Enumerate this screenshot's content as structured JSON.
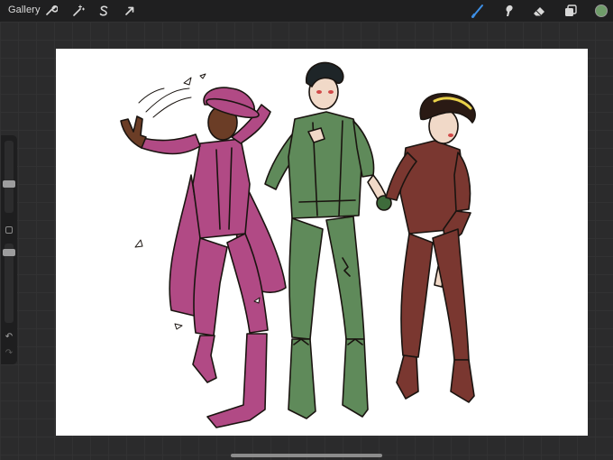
{
  "topbar": {
    "gallery_label": "Gallery",
    "left_tools": [
      {
        "icon": "wrench-icon",
        "name": "actions"
      },
      {
        "icon": "magic-wand-icon",
        "name": "adjustments"
      },
      {
        "icon": "selection-s-icon",
        "name": "selection"
      },
      {
        "icon": "arrow-cursor-icon",
        "name": "transform"
      }
    ],
    "right_tools": [
      {
        "icon": "brush-icon",
        "name": "brush",
        "active": true
      },
      {
        "icon": "smudge-icon",
        "name": "smudge"
      },
      {
        "icon": "eraser-icon",
        "name": "eraser"
      },
      {
        "icon": "layers-icon",
        "name": "layers"
      }
    ],
    "active_color": "#6f9c6a"
  },
  "sidebar": {
    "undo_icon": "↶",
    "redo_icon": "↷"
  },
  "colors": {
    "active_tool": "#3d8fe6",
    "magenta_outfit": "#b14a85",
    "green_outfit": "#5f8a5a",
    "brown_outfit": "#7a3730",
    "skin_dark": "#6b3d26",
    "skin_light": "#f1d9c8"
  }
}
